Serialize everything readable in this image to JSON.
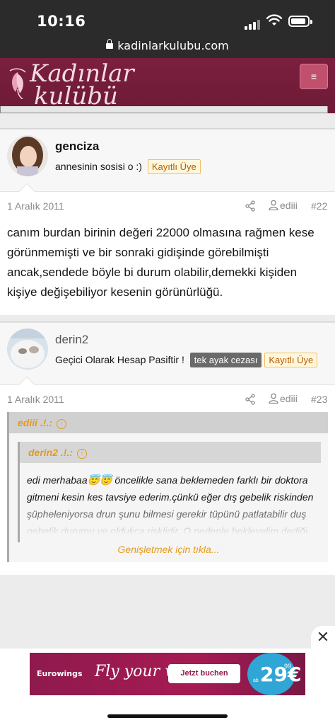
{
  "status_bar": {
    "time": "10:16"
  },
  "browser": {
    "url": "kadinlarkulubu.com"
  },
  "site": {
    "logo_line1": "Kadınlar",
    "logo_line2": "kulübü",
    "menu_icon": "hamburger-icon",
    "brand_color": "#7b1f3e"
  },
  "posts": [
    {
      "username": "genciza",
      "user_title": "annesinin sosisi o :)",
      "badges": [
        "Kayıtlı Üye"
      ],
      "date": "1 Aralık 2011",
      "author": "ediii",
      "number": "#22",
      "message": "canım burdan birinin değeri 22000 olmasına rağmen kese görünmemişti ve bir sonraki gidişinde görebilmişti ancak,sendede böyle bi durum olabilir,demekki kişiden kişiye değişebiliyor kesenin görünürlüğü."
    },
    {
      "username": "derin2",
      "user_title": "Geçici Olarak Hesap Pasiftir !",
      "badges": [
        "tek ayak cezası",
        "Kayıtlı Üye"
      ],
      "date": "1 Aralık 2011",
      "author": "ediii",
      "number": "#23",
      "quote_outer_author": "ediii .!.:",
      "quote_inner_author": "derin2 .!.:",
      "quote_text_1": "edi merhabaa",
      "quote_text_2": " öncelikle sana beklemeden farklı bir doktora gitmeni kesin kes tavsiye ederim.çünkü eğer dış gebelik riskinden şüpheleniyorsa drun şunu bilmesi gerekir tüpünü patlatabilir duş gebelik durumu ve oldukça risklidir..O nedenle bekleyelim dediği zaman aralığı ben",
      "expand_label": "Genişletmek için tıkla..."
    }
  ],
  "ad": {
    "brand": "Eurowings",
    "slogan": "Fly your way",
    "cta": "Jetzt buchen",
    "prefix": "ab",
    "price": "29",
    "cents": "99",
    "currency": "€"
  },
  "close_label": "✕"
}
